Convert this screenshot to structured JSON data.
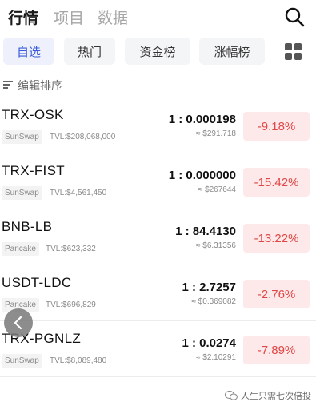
{
  "top_tabs": [
    {
      "label": "行情",
      "active": true
    },
    {
      "label": "项目",
      "active": false
    },
    {
      "label": "数据",
      "active": false
    }
  ],
  "chips": [
    {
      "label": "自选",
      "active": true
    },
    {
      "label": "热门",
      "active": false
    },
    {
      "label": "资金榜",
      "active": false
    },
    {
      "label": "涨幅榜",
      "active": false
    }
  ],
  "sort_label": "编辑排序",
  "rows": [
    {
      "pair": "TRX-OSK",
      "dex": "SunSwap",
      "tvl": "TVL:$208,068,000",
      "ratio": "1 : 0.000198",
      "usd": "≈ $291.718",
      "change": "-9.18%"
    },
    {
      "pair": "TRX-FIST",
      "dex": "SunSwap",
      "tvl": "TVL:$4,561,450",
      "ratio": "1 : 0.000000",
      "usd": "≈ $267644",
      "change": "-15.42%"
    },
    {
      "pair": "BNB-LB",
      "dex": "Pancake",
      "tvl": "TVL:$623,332",
      "ratio": "1 : 84.4130",
      "usd": "≈ $6.31356",
      "change": "-13.22%"
    },
    {
      "pair": "USDT-LDC",
      "dex": "Pancake",
      "tvl": "TVL:$696,829",
      "ratio": "1 : 2.7257",
      "usd": "≈ $0.369082",
      "change": "-2.76%"
    },
    {
      "pair": "TRX-PGNLZ",
      "dex": "SunSwap",
      "tvl": "TVL:$8,089,480",
      "ratio": "1 : 0.0274",
      "usd": "≈ $2.10291",
      "change": "-7.89%"
    }
  ],
  "watermark": "人生只需七次倍投",
  "colors": {
    "accent": "#3b5bdb",
    "down": "#e04747",
    "down_bg": "#fde9e9"
  },
  "icons": {
    "search": "search-icon",
    "grid": "grid-icon",
    "sort": "sort-lines-icon",
    "back": "chevron-left-icon",
    "watermark": "wechat-icon"
  }
}
